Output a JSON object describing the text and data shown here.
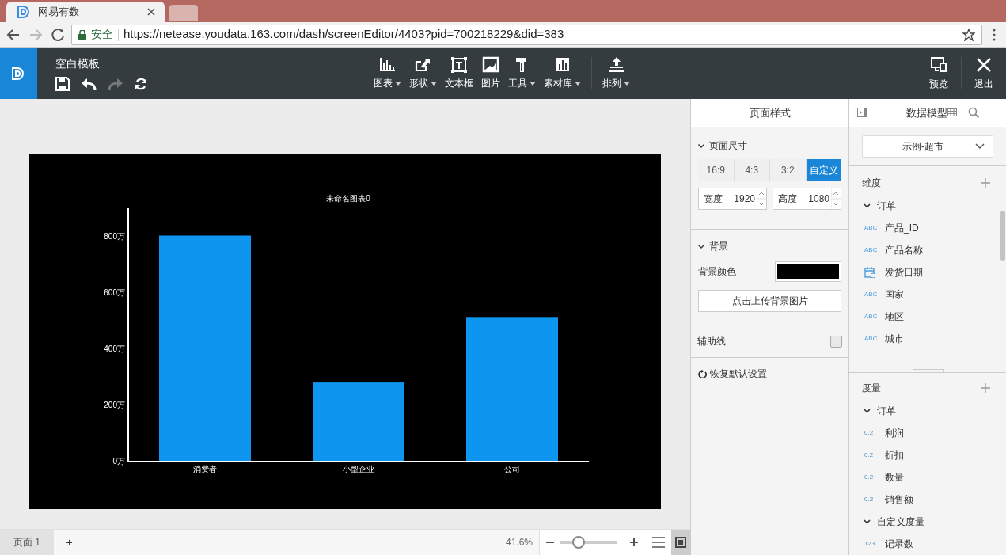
{
  "browser": {
    "tab_title": "网易有数",
    "security": "安全",
    "url": "https://netease.youdata.163.com/dash/screenEditor/4403?pid=700218229&did=383"
  },
  "toolbar": {
    "title": "空白模板",
    "tools": [
      {
        "label": "图表",
        "dropdown": true
      },
      {
        "label": "形状",
        "dropdown": true
      },
      {
        "label": "文本框",
        "dropdown": false
      },
      {
        "label": "图片",
        "dropdown": false
      },
      {
        "label": "工具",
        "dropdown": true
      },
      {
        "label": "素材库",
        "dropdown": true
      },
      {
        "label": "排列",
        "dropdown": true
      }
    ],
    "actions": [
      {
        "label": "预览"
      },
      {
        "label": "退出"
      }
    ]
  },
  "canvas": {
    "chart_data": {
      "type": "bar",
      "title": "未命名图表0",
      "categories": [
        "消费者",
        "小型企业",
        "公司"
      ],
      "series": [
        {
          "color": "#0d95f0",
          "values": [
            803,
            281,
            511
          ]
        }
      ],
      "ylim": [
        0,
        900
      ],
      "yticks": [
        {
          "value": 0,
          "label": "0万"
        },
        {
          "value": 200,
          "label": "200万"
        },
        {
          "value": 400,
          "label": "400万"
        },
        {
          "value": 600,
          "label": "600万"
        },
        {
          "value": 800,
          "label": "800万"
        }
      ]
    }
  },
  "bottom_bar": {
    "pages": [
      {
        "label": "页面 1",
        "selected": true
      }
    ],
    "add": "+",
    "zoom": "41.6%",
    "zoom_slider": {
      "level": 0.27
    }
  },
  "style_panel": {
    "title": "页面样式",
    "page_size": {
      "heading": "页面尺寸",
      "presets": [
        {
          "label": "16:9",
          "selected": false
        },
        {
          "label": "4:3",
          "selected": false
        },
        {
          "label": "3:2",
          "selected": false
        },
        {
          "label": "自定义",
          "selected": true
        }
      ],
      "width": {
        "label": "宽度",
        "value": "1920"
      },
      "height": {
        "label": "高度",
        "value": "1080"
      }
    },
    "background": {
      "heading": "背景",
      "color_label": "背景颜色",
      "color": "#000000",
      "upload": "点击上传背景图片"
    },
    "guides": {
      "label": "辅助线",
      "checked": false
    },
    "reset": "恢复默认设置"
  },
  "data_panel": {
    "title": "数据模型",
    "dataset": "示例-超市",
    "dimensions": {
      "heading": "维度",
      "groups": [
        {
          "name": "订单",
          "expanded": true,
          "fields": [
            {
              "kind": "text",
              "badge": "ABC",
              "name": "产品_ID"
            },
            {
              "kind": "text",
              "badge": "ABC",
              "name": "产品名称"
            },
            {
              "kind": "date",
              "name": "发货日期"
            },
            {
              "kind": "text",
              "badge": "ABC",
              "name": "国家"
            },
            {
              "kind": "text",
              "badge": "ABC",
              "name": "地区"
            },
            {
              "kind": "text",
              "badge": "ABC",
              "name": "城市"
            }
          ]
        }
      ]
    },
    "measures": {
      "heading": "度量",
      "groups": [
        {
          "name": "订单",
          "expanded": true,
          "fields": [
            {
              "kind": "number",
              "badge": "0.2",
              "name": "利润"
            },
            {
              "kind": "number",
              "badge": "0.2",
              "name": "折扣"
            },
            {
              "kind": "number",
              "badge": "0.2",
              "name": "数量"
            },
            {
              "kind": "number",
              "badge": "0.2",
              "name": "销售额"
            }
          ]
        },
        {
          "name": "自定义度量",
          "expanded": true,
          "fields": [
            {
              "kind": "number",
              "badge": "123",
              "name": "记录数"
            }
          ]
        }
      ]
    }
  }
}
